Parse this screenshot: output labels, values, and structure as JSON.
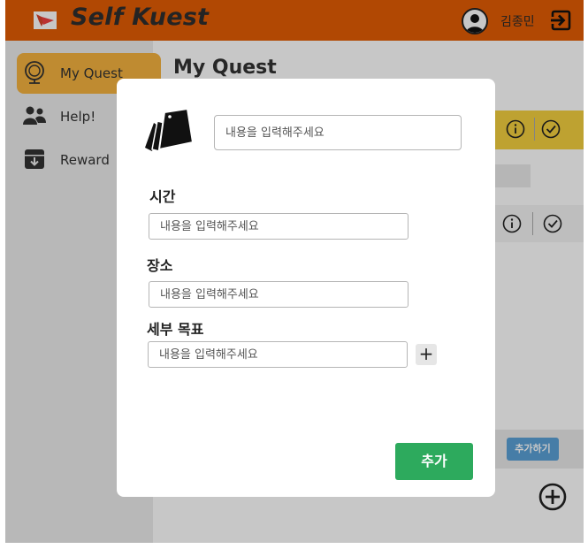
{
  "colors": {
    "header_bg": "#e35d05",
    "sidebar_active": "#f5b23f",
    "card_yellow": "#f4d03f",
    "add_button": "#5aa0d6",
    "submit_button": "#2daa5d"
  },
  "header": {
    "app_title": "Self Kuest",
    "username": "김종민",
    "logo_icon": "flag-logo-icon",
    "avatar_icon": "user-avatar-icon",
    "logout_icon": "logout-icon"
  },
  "sidebar": {
    "items": [
      {
        "label": "My Quest",
        "icon": "globe-icon",
        "active": true
      },
      {
        "label": "Help!",
        "icon": "users-icon",
        "active": false
      },
      {
        "label": "Reward",
        "icon": "archive-icon",
        "active": false
      }
    ]
  },
  "main": {
    "title": "My Quest",
    "add_button_label": "추가하기"
  },
  "modal": {
    "title_placeholder": "내용을 입력해주세요",
    "time_label": "시간",
    "time_placeholder": "내용을 입력해주세요",
    "place_label": "장소",
    "place_placeholder": "내용을 입력해주세요",
    "detail_label": "세부 목표",
    "detail_placeholder": "내용을 입력해주세요",
    "add_detail_symbol": "+",
    "submit_label": "추가"
  }
}
